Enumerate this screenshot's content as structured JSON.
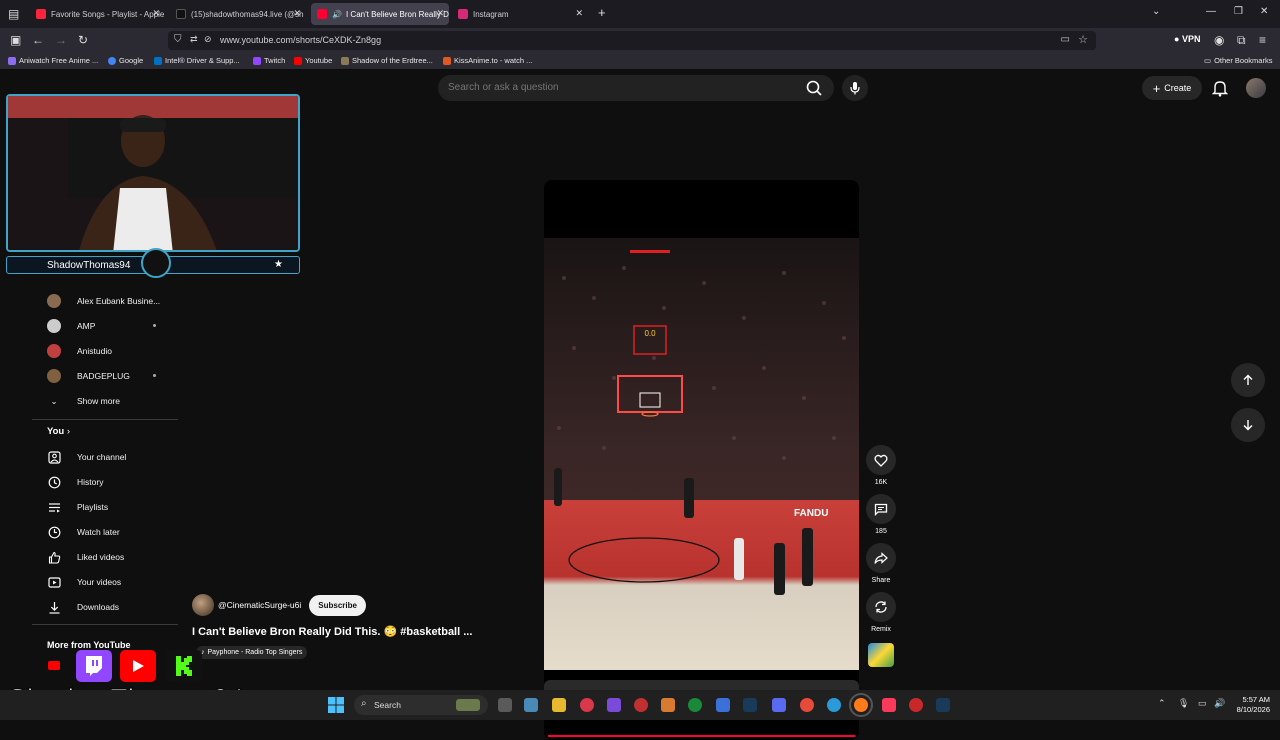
{
  "browser": {
    "tabs": [
      {
        "title": "Favorite Songs - Playlist - Apple",
        "color": "#fa243c"
      },
      {
        "title": "(15)shadowthomas94.live (@sh",
        "color": "#111111"
      },
      {
        "title": "I Can't Believe Bron Really D",
        "color": "#ff0033",
        "active": true
      },
      {
        "title": "Instagram",
        "color": "#d62976"
      }
    ],
    "url": "www.youtube.com/shorts/CeXDK-Zn8gg",
    "vpn_label": "VPN",
    "bookmarks": [
      {
        "label": "Aniwatch Free Anime ...",
        "color": "#8e6cf0"
      },
      {
        "label": "Google",
        "color": "#4285f4"
      },
      {
        "label": "Intel® Driver & Supp...",
        "color": "#0071c5"
      },
      {
        "label": "Twitch",
        "color": "#9146ff"
      },
      {
        "label": "Youtube",
        "color": "#ff0000"
      },
      {
        "label": "Shadow of the Erdtree...",
        "color": "#8a7a5a"
      },
      {
        "label": "KissAnime.to - watch ...",
        "color": "#e05a20"
      }
    ],
    "other_bookmarks": "Other Bookmarks"
  },
  "youtube": {
    "logo": "YouTube",
    "search_placeholder": "Search or ask a question",
    "create_label": "Create",
    "sidebar": {
      "subscriptions": [
        {
          "name": "Alex Eubank Busine...",
          "color": "#8a6a50",
          "dot": false
        },
        {
          "name": "AMP",
          "color": "#cccccc",
          "dot": true
        },
        {
          "name": "Anistudio",
          "color": "#c04040",
          "dot": false
        },
        {
          "name": "BADGEPLUG",
          "color": "#806040",
          "dot": true
        }
      ],
      "show_more": "Show more",
      "you_heading": "You",
      "you_items": [
        {
          "label": "Your channel",
          "icon": "channel-icon"
        },
        {
          "label": "History",
          "icon": "history-icon"
        },
        {
          "label": "Playlists",
          "icon": "playlists-icon"
        },
        {
          "label": "Watch later",
          "icon": "watch-later-icon"
        },
        {
          "label": "Liked videos",
          "icon": "thumbs-up-icon"
        },
        {
          "label": "Your videos",
          "icon": "video-icon"
        },
        {
          "label": "Downloads",
          "icon": "download-icon"
        }
      ],
      "more_heading": "More from YouTube"
    },
    "short": {
      "channel": "@CinematicSurge-u6i",
      "subscribe_label": "Subscribe",
      "title": "I Can't Believe Bron Really Did This. 😳 #basketball ...",
      "sound": "Payphone - Radio Top Singers",
      "scoreboard": "0.0",
      "progress_fraction": 1.0,
      "actions": [
        {
          "label": "16K",
          "icon": "like-icon"
        },
        {
          "label": "185",
          "icon": "comment-icon"
        },
        {
          "label": "Share",
          "icon": "share-icon"
        },
        {
          "label": "Remix",
          "icon": "remix-icon"
        }
      ]
    }
  },
  "overlay": {
    "cam_name": "ShadowThomas94",
    "big_name": "ShadowThomas94"
  },
  "taskbar": {
    "search_label": "Search",
    "time": "5:57 AM",
    "date": "8/10/2026"
  }
}
